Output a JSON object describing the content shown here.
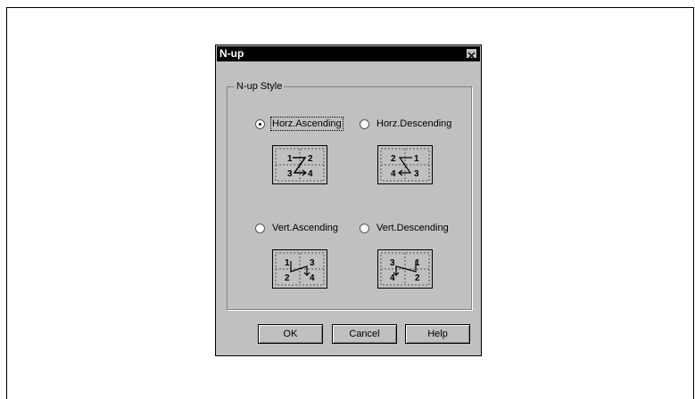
{
  "dialog": {
    "title": "N-up",
    "close_label": "✕",
    "group_label": "N-up Style",
    "options": [
      {
        "label": "Horz.Ascending",
        "selected": true,
        "icon": "horz-ascending-icon",
        "numbers": [
          "1",
          "2",
          "3",
          "4"
        ]
      },
      {
        "label": "Horz.Descending",
        "selected": false,
        "icon": "horz-descending-icon",
        "numbers": [
          "2",
          "1",
          "4",
          "3"
        ]
      },
      {
        "label": "Vert.Ascending",
        "selected": false,
        "icon": "vert-ascending-icon",
        "numbers": [
          "1",
          "3",
          "2",
          "4"
        ]
      },
      {
        "label": "Vert.Descending",
        "selected": false,
        "icon": "vert-descending-icon",
        "numbers": [
          "3",
          "1",
          "4",
          "2"
        ]
      }
    ],
    "buttons": {
      "ok": "OK",
      "cancel": "Cancel",
      "help": "Help"
    }
  }
}
